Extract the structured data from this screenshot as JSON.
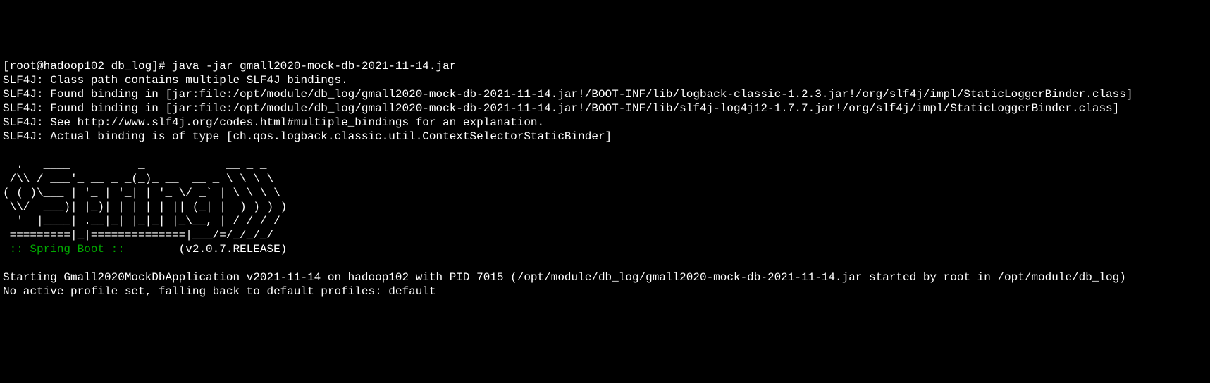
{
  "terminal": {
    "prompt": "[root@hadoop102 db_log]# ",
    "command": "java -jar gmall2020-mock-db-2021-11-14.jar",
    "lines": [
      "SLF4J: Class path contains multiple SLF4J bindings.",
      "SLF4J: Found binding in [jar:file:/opt/module/db_log/gmall2020-mock-db-2021-11-14.jar!/BOOT-INF/lib/logback-classic-1.2.3.jar!/org/slf4j/impl/StaticLoggerBinder.class]",
      "SLF4J: Found binding in [jar:file:/opt/module/db_log/gmall2020-mock-db-2021-11-14.jar!/BOOT-INF/lib/slf4j-log4j12-1.7.7.jar!/org/slf4j/impl/StaticLoggerBinder.class]",
      "SLF4J: See http://www.slf4j.org/codes.html#multiple_bindings for an explanation.",
      "SLF4J: Actual binding is of type [ch.qos.logback.classic.util.ContextSelectorStaticBinder]",
      "",
      "  .   ____          _            __ _ _",
      " /\\\\ / ___'_ __ _ _(_)_ __  __ _ \\ \\ \\ \\",
      "( ( )\\___ | '_ | '_| | '_ \\/ _` | \\ \\ \\ \\",
      " \\\\/  ___)| |_)| | | | | || (_| |  ) ) ) )",
      "  '  |____| .__|_| |_|_| |_\\__, | / / / /",
      " =========|_|==============|___/=/_/_/_/"
    ],
    "springBootLabel": " :: Spring Boot :: ",
    "springBootVersion": "       (v2.0.7.RELEASE)",
    "afterLines": [
      "",
      "Starting Gmall2020MockDbApplication v2021-11-14 on hadoop102 with PID 7015 (/opt/module/db_log/gmall2020-mock-db-2021-11-14.jar started by root in /opt/module/db_log)",
      "No active profile set, falling back to default profiles: default"
    ]
  }
}
